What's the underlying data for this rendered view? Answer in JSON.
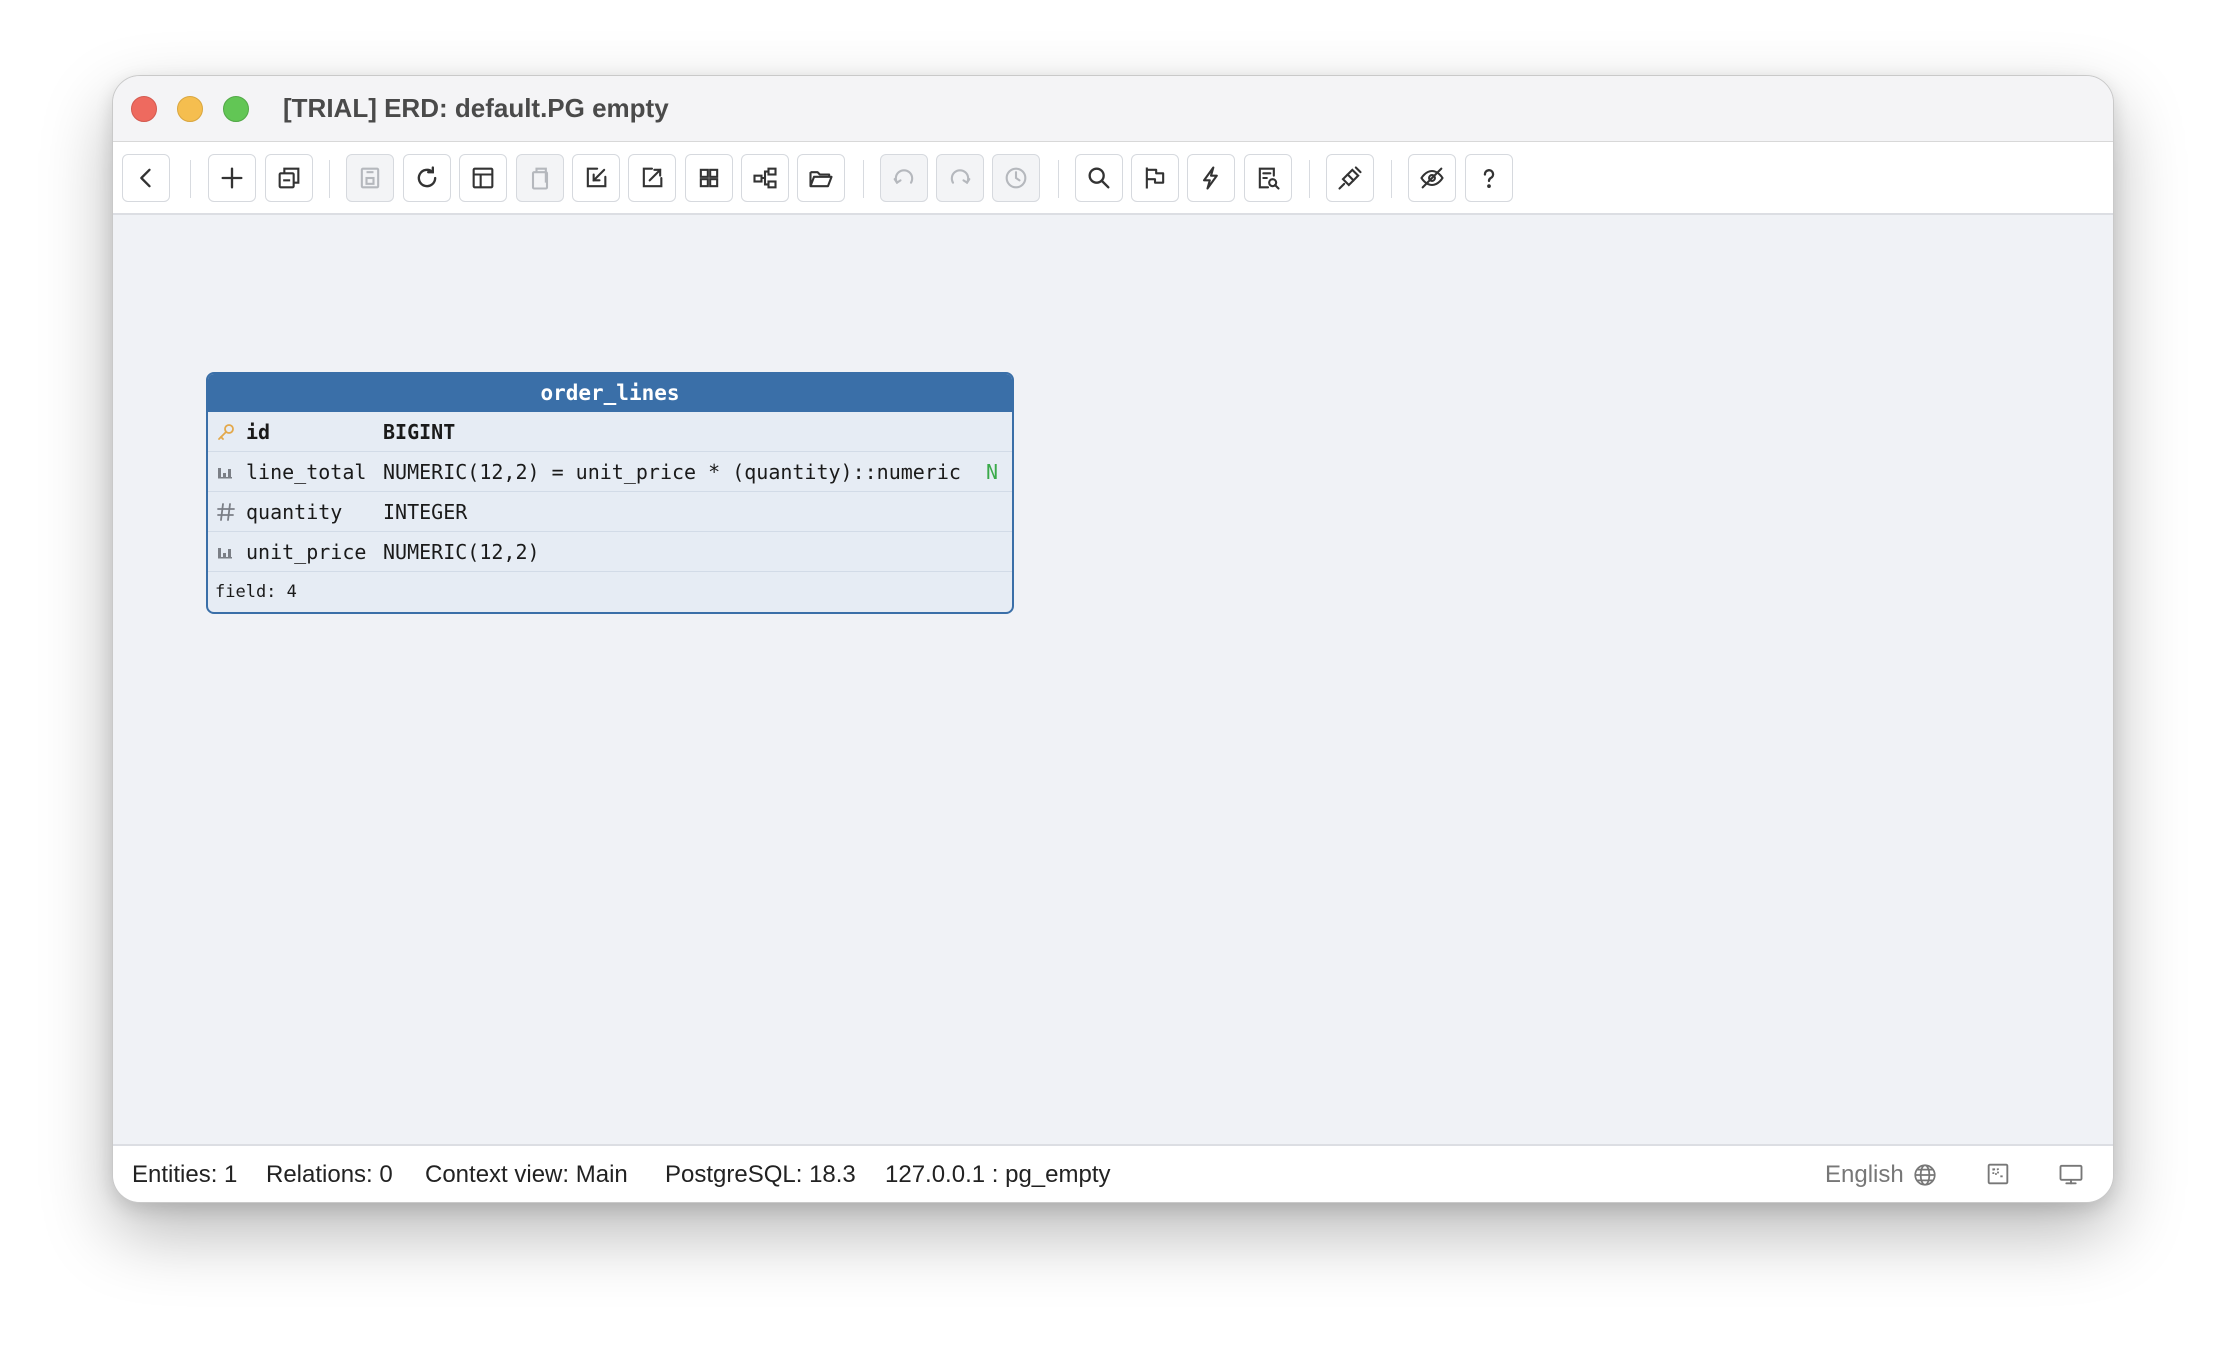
{
  "window": {
    "title": "[TRIAL] ERD: default.PG empty"
  },
  "toolbar": {
    "buttons": [
      {
        "name": "back",
        "icon": "chevron-left-icon",
        "enabled": true
      },
      {
        "name": "add",
        "icon": "plus-icon",
        "enabled": true
      },
      {
        "name": "copy-view",
        "icon": "copy-icon",
        "enabled": true
      },
      {
        "name": "save",
        "icon": "save-icon",
        "enabled": false
      },
      {
        "name": "refresh",
        "icon": "refresh-icon",
        "enabled": true
      },
      {
        "name": "layout",
        "icon": "layout-icon",
        "enabled": true
      },
      {
        "name": "clipboard",
        "icon": "clipboard-icon",
        "enabled": false
      },
      {
        "name": "import",
        "icon": "import-icon",
        "enabled": true
      },
      {
        "name": "export",
        "icon": "export-icon",
        "enabled": true
      },
      {
        "name": "grid",
        "icon": "grid-icon",
        "enabled": true
      },
      {
        "name": "relations",
        "icon": "hierarchy-icon",
        "enabled": true
      },
      {
        "name": "open",
        "icon": "folder-open-icon",
        "enabled": true
      },
      {
        "name": "undo",
        "icon": "undo-icon",
        "enabled": false
      },
      {
        "name": "redo",
        "icon": "redo-icon",
        "enabled": false
      },
      {
        "name": "history",
        "icon": "history-icon",
        "enabled": false
      },
      {
        "name": "search",
        "icon": "search-icon",
        "enabled": true
      },
      {
        "name": "flag",
        "icon": "flag-icon",
        "enabled": true
      },
      {
        "name": "quick-action",
        "icon": "lightning-icon",
        "enabled": true
      },
      {
        "name": "inspect",
        "icon": "document-search-icon",
        "enabled": true
      },
      {
        "name": "connect",
        "icon": "plug-icon",
        "enabled": true
      },
      {
        "name": "hide",
        "icon": "eye-off-icon",
        "enabled": true
      },
      {
        "name": "help",
        "icon": "help-icon",
        "enabled": true
      }
    ]
  },
  "entity": {
    "name": "order_lines",
    "fields": [
      {
        "name": "id",
        "type": "BIGINT",
        "icon": "key-icon",
        "flag": ""
      },
      {
        "name": "line_total",
        "type": "NUMERIC(12,2)  = unit_price * (quantity)::numeric",
        "icon": "numeric-column-icon",
        "flag": "N"
      },
      {
        "name": "quantity",
        "type": "INTEGER",
        "icon": "hash-icon",
        "flag": ""
      },
      {
        "name": "unit_price",
        "type": "NUMERIC(12,2)",
        "icon": "numeric-column-icon",
        "flag": ""
      }
    ],
    "footer": "field: 4"
  },
  "status": {
    "entities": "Entities: 1",
    "relations": "Relations: 0",
    "context_view": "Context view: Main",
    "db_version": "PostgreSQL: 18.3",
    "connection": "127.0.0.1 : pg_empty",
    "language": "English"
  },
  "colors": {
    "entity_header": "#3a6fa8",
    "key_icon": "#e3a84a",
    "nullable_flag": "#3aaa4a"
  }
}
